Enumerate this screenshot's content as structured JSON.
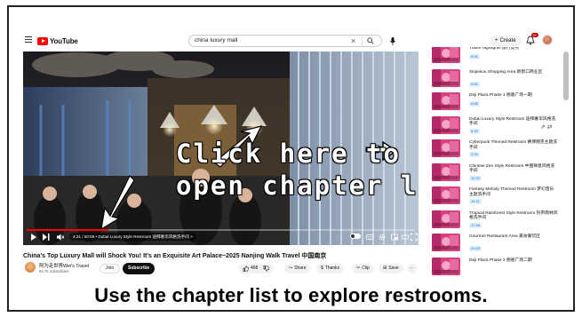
{
  "header": {
    "logo_text": "YouTube",
    "search_value": "china luxury mall",
    "create_label": "Create",
    "notification_count": "9+"
  },
  "player": {
    "progress_fraction": 0.21,
    "time_text": "4:21 / 50:56 • Dubai Luxury Style Restroom 迪拜奢华风格洗手间 >",
    "overlay_line1": "Click here to",
    "overlay_line2": "open chapter list",
    "accent_color": "#ff0000"
  },
  "video": {
    "title": "China's Top Luxury Mall will Shock You!  It's an Exquisite Art Palace~2025 Nanjing Walk Travel 中国南京",
    "channel_name": "阿为走世界Wei's Travel",
    "subscribers": "94.7K subscribers",
    "join_label": "Join",
    "subscribe_label": "Subscribe",
    "likes": "468",
    "share_label": "Share",
    "thanks_label": "Thanks",
    "clip_label": "Clip",
    "save_label": "Save",
    "more_label": "···"
  },
  "chapters": [
    {
      "title": "Travel Highlights 旅行亮点",
      "time": "0:00"
    },
    {
      "title": "Xinjiekou Shopping Area 新街口商业区",
      "time": "0:00"
    },
    {
      "title": "Deji Plaza Phase 1 德基广场一期",
      "time": "0:08"
    },
    {
      "title": "Dubai Luxury Style Restroom 迪拜奢华风格洗手间",
      "time": "0:33"
    },
    {
      "title": "Cyberpunk Themed Restroom 赛博朋克主题洗手间",
      "time": "2:24"
    },
    {
      "title": "Chinese Zen Style Restroom 中国禅意风格洗手间",
      "time": "11:23"
    },
    {
      "title": "Fantasy Melody Themed Restroom 梦幻音乐主题洗手间",
      "time": "14:11"
    },
    {
      "title": "Tropical Rainforest Style Restroom 热带雨林风格洗手间",
      "time": "17:26"
    },
    {
      "title": "Gourmet Restaurant Area 美食餐饮区",
      "time": "21:03"
    },
    {
      "title": "Deji Plaza Phase 2 德基广场二期",
      "time": ""
    }
  ],
  "caption": {
    "text": "Use the chapter list to explore restrooms."
  }
}
